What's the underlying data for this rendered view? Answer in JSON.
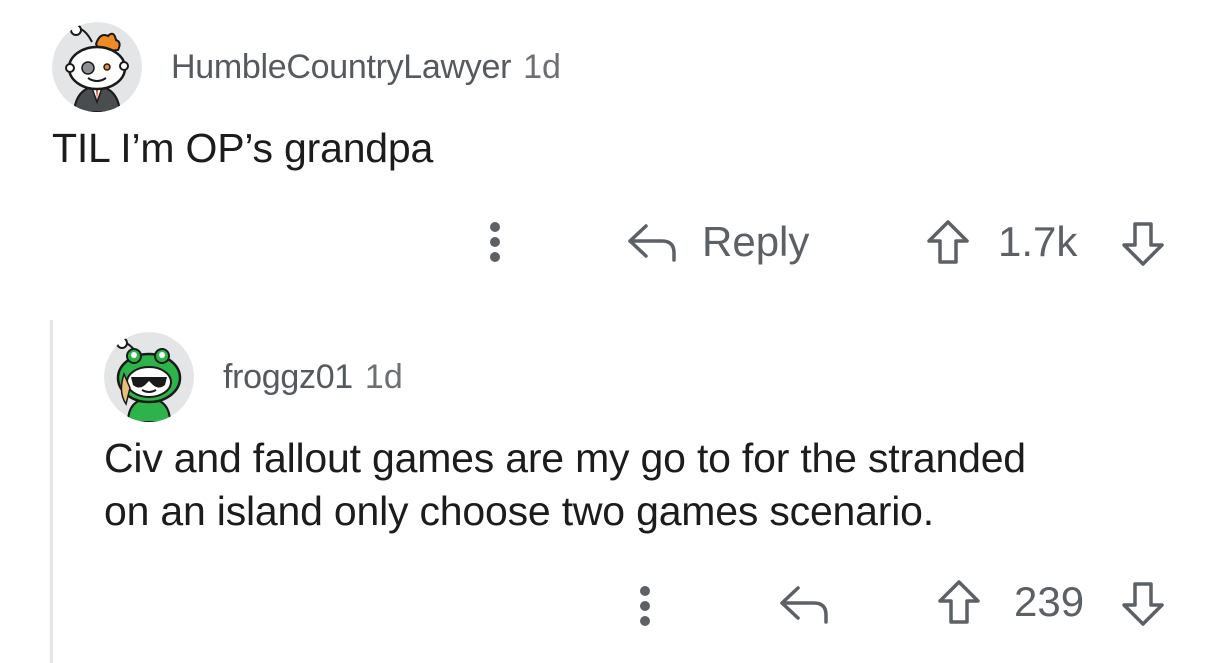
{
  "comments": [
    {
      "username": "HumbleCountryLawyer",
      "age": "1d",
      "text": "TIL I’m OP’s grandpa",
      "reply_label": "Reply",
      "votes": "1.7k"
    },
    {
      "username": "froggz01",
      "age": "1d",
      "text_lines": [
        "Civ and fallout games are my go to for the stranded",
        "on an island only choose two games scenario."
      ],
      "votes": "239"
    }
  ],
  "icons": {
    "more": "more-options-icon",
    "reply": "reply-arrow-icon",
    "upvote": "upvote-icon",
    "downvote": "downvote-icon"
  },
  "colors": {
    "text": "#1c1c1c",
    "meta": "#555a5e",
    "actions": "#5c6166",
    "thread_line": "#e4e6e8",
    "avatar_bg": "#e3e5e7",
    "frog_green": "#2db34a"
  }
}
